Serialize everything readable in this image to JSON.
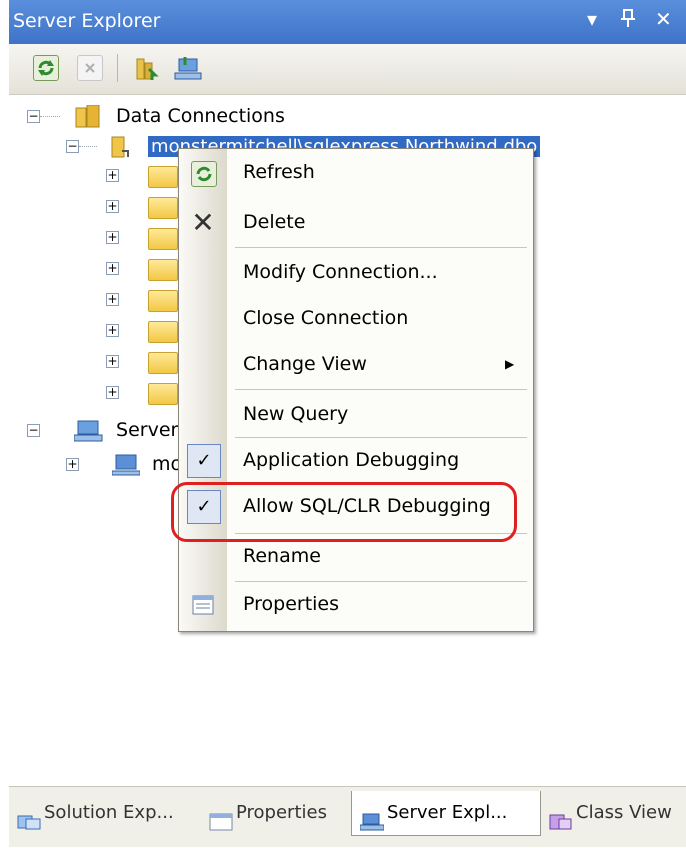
{
  "window": {
    "title": "Server Explorer",
    "controls": [
      "▾",
      "ꟽ",
      "✕"
    ]
  },
  "toolbar": {
    "refresh": "refresh-icon",
    "stop": "stop-icon",
    "connect_db": "connect-to-database-icon",
    "connect_server": "connect-to-server-icon"
  },
  "tree": {
    "data_connections": "Data Connections",
    "connection": "monstermitchell\\sqlexpress.Northwind.dbo",
    "servers": "Server",
    "machine": "mo",
    "expanders": {
      "expanded": "−",
      "collapsed": "+"
    }
  },
  "context_menu": {
    "items": [
      {
        "label": "Refresh",
        "icon": "refresh-icon"
      },
      {
        "label": "Delete",
        "icon": "delete-x-icon"
      },
      {
        "label": "Modify Connection..."
      },
      {
        "label": "Close Connection"
      },
      {
        "label": "Change View",
        "submenu_arrow": "▶"
      },
      {
        "label": "New Query"
      },
      {
        "label": "Application Debugging",
        "checked": true
      },
      {
        "label": "Allow SQL/CLR Debugging",
        "checked": true
      },
      {
        "label": "Rename"
      },
      {
        "label": "Properties",
        "icon": "properties-icon"
      }
    ],
    "check_glyph": "✓",
    "delete_glyph": "✕"
  },
  "tabs": [
    {
      "label": "Solution Exp...",
      "active": false
    },
    {
      "label": "Properties",
      "active": false
    },
    {
      "label": "Server Expl...",
      "active": true
    },
    {
      "label": "Class View",
      "active": false
    }
  ],
  "colors": {
    "title_bar": "#4a80d4",
    "selection": "#316ac5",
    "annotation": "#e02020"
  }
}
